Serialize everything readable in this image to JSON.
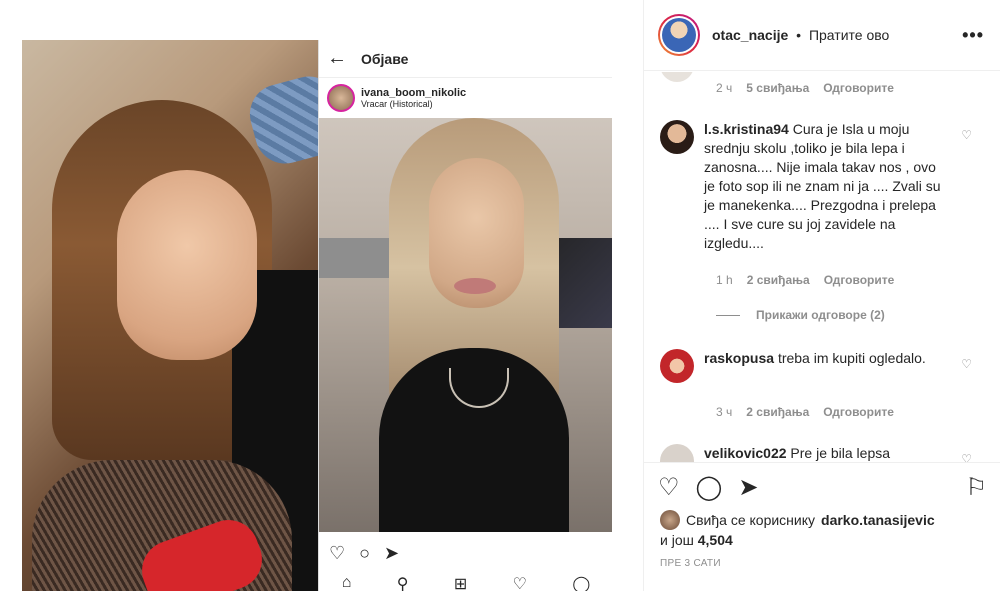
{
  "phone": {
    "header_title": "Објаве",
    "username": "ivana_boom_nikolic",
    "location": "Vracar (Historical)"
  },
  "post": {
    "author": "otac_nacije",
    "separator": "•",
    "follow_label": "Пратите ово",
    "more": "•••"
  },
  "comments": [
    {
      "time": "2 ч",
      "likes": "5 свиђања",
      "reply": "Одговорите"
    },
    {
      "user": "l.s.kristina94",
      "text": "Cura je Isla u moju srednju skolu ,toliko je bila lepa i zanosna.... Nije imala takav nos , ovo je foto sop ili ne znam ni ja .... Zvali su je manekenka.... Prezgodna i prelepa .... I sve cure su joj zavidele na izgledu....",
      "time": "1 h",
      "likes": "2 свиђања",
      "reply": "Одговорите"
    },
    {
      "user": "raskopusa",
      "text": "treba im kupiti ogledalo.",
      "time": "3 ч",
      "likes": "2 свиђања",
      "reply": "Одговорите"
    },
    {
      "user": "velikovic022",
      "text": "Pre je bila lepsa"
    }
  ],
  "show_replies": "Прикажи одговоре (2)",
  "likes": {
    "prefix": "Свиђа се кориснику",
    "user": "darko.tanasijevic",
    "and": "и још",
    "count": "4,504"
  },
  "posted_time": "ПРЕ 3 САТИ",
  "colors": {
    "text": "#262626",
    "muted": "#8e8e8e",
    "border": "#efefef"
  },
  "icons": [
    "heart-icon",
    "comment-icon",
    "share-icon",
    "bookmark-icon",
    "more-icon",
    "back-icon"
  ]
}
